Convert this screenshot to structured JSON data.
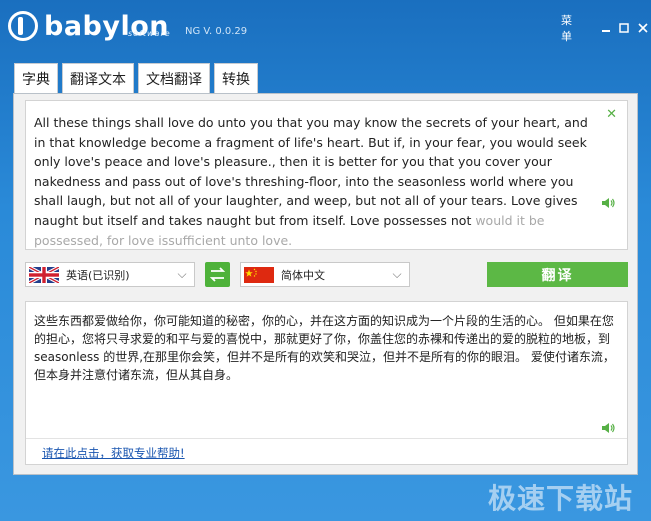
{
  "app": {
    "logo_text": "babylon",
    "logo_sub": "software",
    "version": "NG V. 0.0.29",
    "menu_label": "菜单",
    "minimize_glyph": "—",
    "maximize_glyph": "☐",
    "close_glyph": "✕"
  },
  "tabs": [
    {
      "label": "字典",
      "active": false
    },
    {
      "label": "翻译文本",
      "active": true
    },
    {
      "label": "文档翻译",
      "active": false
    },
    {
      "label": "转换",
      "active": false
    }
  ],
  "source": {
    "text_main": "All these things shall love do unto you that you may know the secrets of your heart, and in that knowledge become a fragment of life's heart. But if, in your fear, you would seek only love's peace and love's pleasure., then it is better for you that you cover your nakedness and pass out of love's threshing-floor, into the seasonless world where you shall laugh, but not all of your laughter, and weep, but not all of your tears. Love gives naught but itself and takes naught but from itself. Love possesses not ",
    "text_dim": "would it be possessed, for love issufficient unto love.",
    "clear_glyph": "✕",
    "speaker_icon": "speaker-icon"
  },
  "language_bar": {
    "source_lang": "英语(已识别)",
    "target_lang": "简体中文",
    "translate_label": "翻译",
    "chevron_glyph": "⌵",
    "swap_glyph": "⇆"
  },
  "target": {
    "text": "这些东西都爱做给你，你可能知道的秘密，你的心，并在这方面的知识成为一个片段的生活的心。 但如果在您的担心，您将只寻求爱的和平与爱的喜悦中，那就更好了你，你盖住您的赤裸和传递出的爱的脱粒的地板，到 seasonless 的世界,在那里你会笑，但并不是所有的欢笑和哭泣，但并不是所有的你的眼泪。 爱使付诸东流，但本身并注意付诸东流，但从其自身。",
    "help_link": "请在此点击，获取专业帮助!"
  },
  "watermark": "极速下载站",
  "colors": {
    "accent_green": "#5cb845",
    "header_blue": "#1a6fbf",
    "link_blue": "#1a56b0"
  }
}
